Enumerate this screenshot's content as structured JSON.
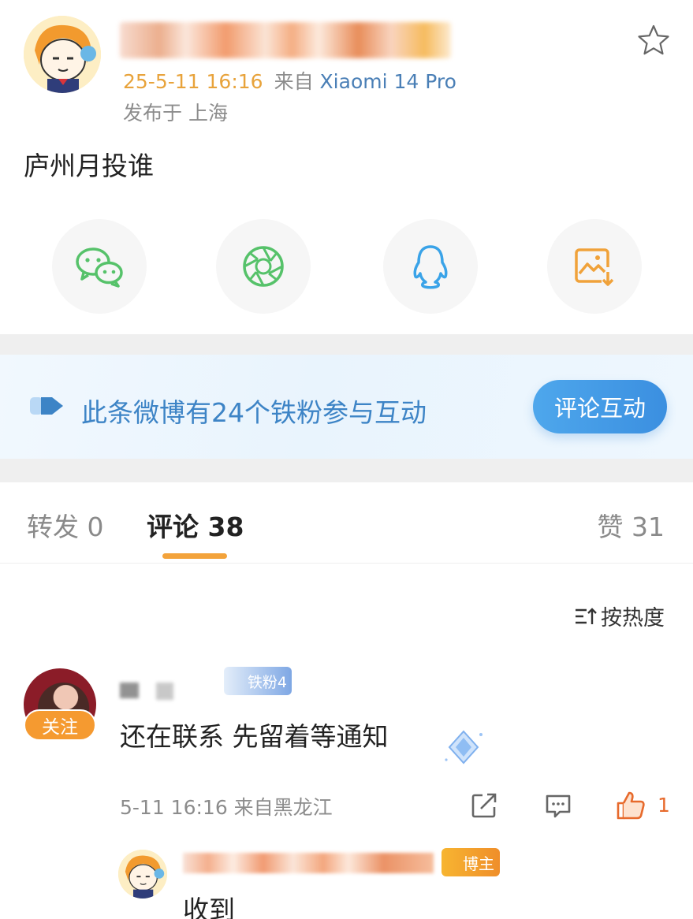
{
  "post": {
    "timestamp": "25-5-11 16:16",
    "source_prefix": "来自",
    "device": "Xiaomi 14 Pro",
    "location": "发布于 上海",
    "text": "庐州月投谁"
  },
  "share": {
    "icons": [
      "wechat-icon",
      "moments-icon",
      "qq-icon",
      "save-image-icon"
    ]
  },
  "fans_banner": {
    "text": "此条微博有24个铁粉参与互动",
    "button": "评论互动"
  },
  "tabs": {
    "repost": "转发 0",
    "comment": "评论 38",
    "like": "赞 31"
  },
  "sort": {
    "label": "按热度"
  },
  "comment": {
    "follow": "关注",
    "fan_badge": "铁粉4",
    "text": "还在联系 先留着等通知",
    "meta": "5-11 16:16  来自黑龙江",
    "like_count": "1"
  },
  "reply": {
    "badge": "博主",
    "text": "收到"
  },
  "colors": {
    "accent_orange": "#f3a33b",
    "link_blue": "#3d84c6",
    "wechat_green": "#56c26a",
    "qq_blue": "#3aa3e8",
    "save_orange": "#f0a23a"
  }
}
